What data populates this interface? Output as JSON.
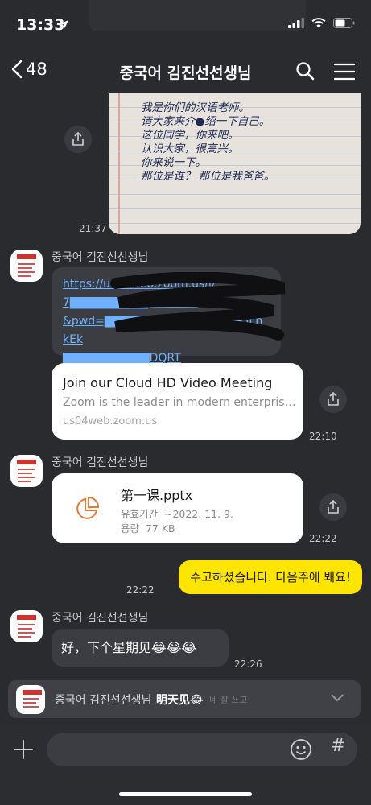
{
  "status_bar": {
    "time": "13:33"
  },
  "header": {
    "back_count": "48",
    "title": "중국어 김진선선생님"
  },
  "photo_message": {
    "handwriting": "我是你们的汉语老师。\n请大家来介●绍一下自己。\n这位同学，你来吧。\n认识大家，很高兴。\n你来说一下。\n那位是谁？ 那位是我爸爸。",
    "time": "21:37"
  },
  "messages": [
    {
      "sender": "중국어 김진선선생님",
      "link_lines": [
        "https://us04web.zoom.us/j/",
        "7▇▇▇▇▇▇▇▇▇8407637",
        "&pwd=▇▇▇▇▇▇▇▇▇MVXO▇▇▇5FhkEk",
        "▇▇▇▇▇▇▇▇▇▇DQRT"
      ],
      "preview": {
        "title": "Join our Cloud HD Video Meeting",
        "desc": "Zoom is the leader in modern enterprise video communications",
        "url": "us04web.zoom.us"
      },
      "time": "22:10"
    },
    {
      "sender": "중국어 김진선선생님",
      "file": {
        "name": "第一课.pptx",
        "validity_label": "유효기간",
        "validity_value": "~2022. 11. 9.",
        "size_label": "용량",
        "size_value": "77 KB"
      },
      "time": "22:22"
    },
    {
      "mine": true,
      "text": "수고하셨습니다. 다음주에 봬요!",
      "time": "22:22"
    },
    {
      "sender": "중국어 김진선선생님",
      "text": "好，下个星期见😂😂😂",
      "time": "22:26"
    }
  ],
  "notice": {
    "name": "중국어 김진선선생님",
    "message": "明天见😂",
    "ghost": "네 잘 쓰고"
  },
  "input": {
    "placeholder": ""
  },
  "colors": {
    "background": "#2a2b2f",
    "my_bubble": "#fee500",
    "link": "#6fb1ff"
  }
}
